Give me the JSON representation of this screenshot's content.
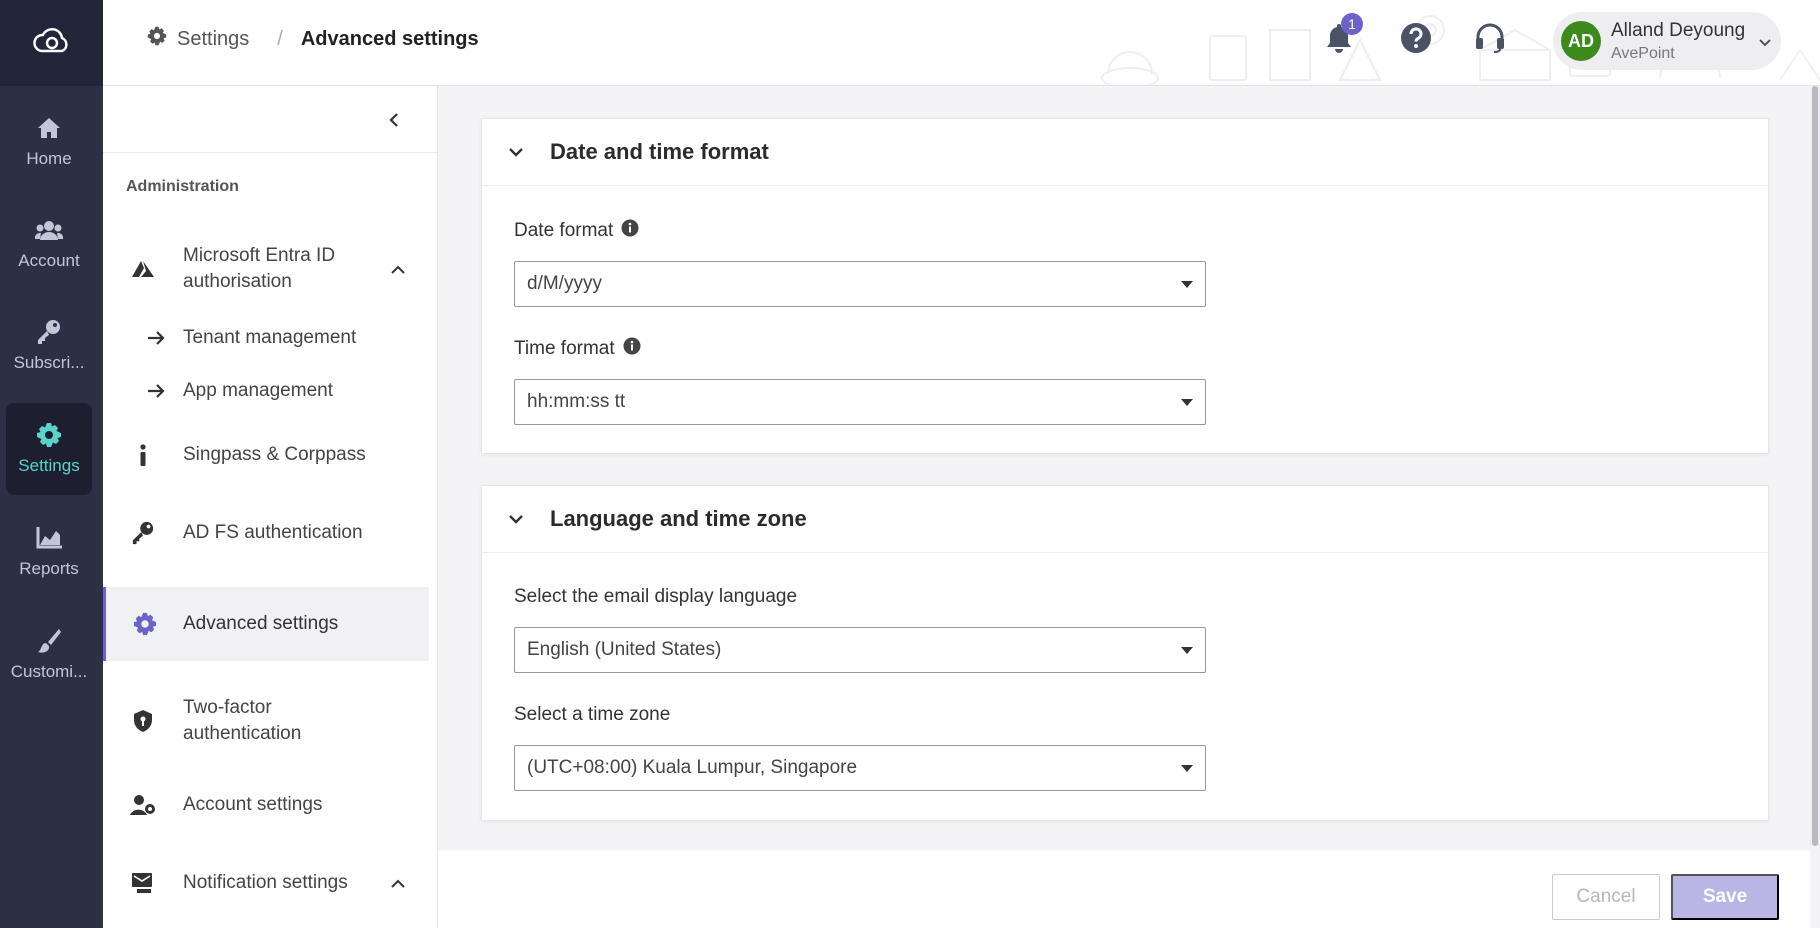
{
  "rail": {
    "items": [
      {
        "label": "Home",
        "icon": "home-icon"
      },
      {
        "label": "Account",
        "icon": "users-icon"
      },
      {
        "label": "Subscri...",
        "icon": "key-icon"
      },
      {
        "label": "Settings",
        "icon": "gear-icon",
        "active": true
      },
      {
        "label": "Reports",
        "icon": "chart-icon"
      },
      {
        "label": "Customi...",
        "icon": "brush-icon"
      }
    ]
  },
  "header": {
    "breadcrumb": {
      "root": "Settings",
      "separator": "/",
      "current": "Advanced settings"
    },
    "notifications_count": "1",
    "user": {
      "initials": "AD",
      "name": "Alland Deyoung",
      "org": "AvePoint"
    }
  },
  "subnav": {
    "section": "Administration",
    "items": [
      {
        "label": "Microsoft Entra ID authorisation",
        "icon": "entra-icon",
        "expanded": true
      },
      {
        "label": "Tenant management",
        "icon": "arrow-right-icon"
      },
      {
        "label": "App management",
        "icon": "arrow-right-icon"
      },
      {
        "label": "Singpass & Corppass",
        "icon": "info-icon"
      },
      {
        "label": "AD FS authentication",
        "icon": "key-icon"
      },
      {
        "label": "Advanced settings",
        "icon": "gear-icon",
        "active": true
      },
      {
        "label": "Two-factor authentication",
        "icon": "shield-icon"
      },
      {
        "label": "Account settings",
        "icon": "user-gear-icon"
      },
      {
        "label": "Notification settings",
        "icon": "notification-icon",
        "expanded": true
      }
    ]
  },
  "sections": {
    "date_time": {
      "title": "Date and time format",
      "date_label": "Date format",
      "date_value": "d/M/yyyy",
      "time_label": "Time format",
      "time_value": "hh:mm:ss tt"
    },
    "language": {
      "title": "Language and time zone",
      "lang_label": "Select the email display language",
      "lang_value": "English (United States)",
      "tz_label": "Select a time zone",
      "tz_value": "(UTC+08:00) Kuala Lumpur, Singapore"
    }
  },
  "footer": {
    "cancel": "Cancel",
    "save": "Save"
  },
  "colors": {
    "accent": "#6b63c7",
    "rail_bg": "#2d2f45",
    "active_teal": "#5ad3c9",
    "avatar": "#3c8a1c"
  }
}
